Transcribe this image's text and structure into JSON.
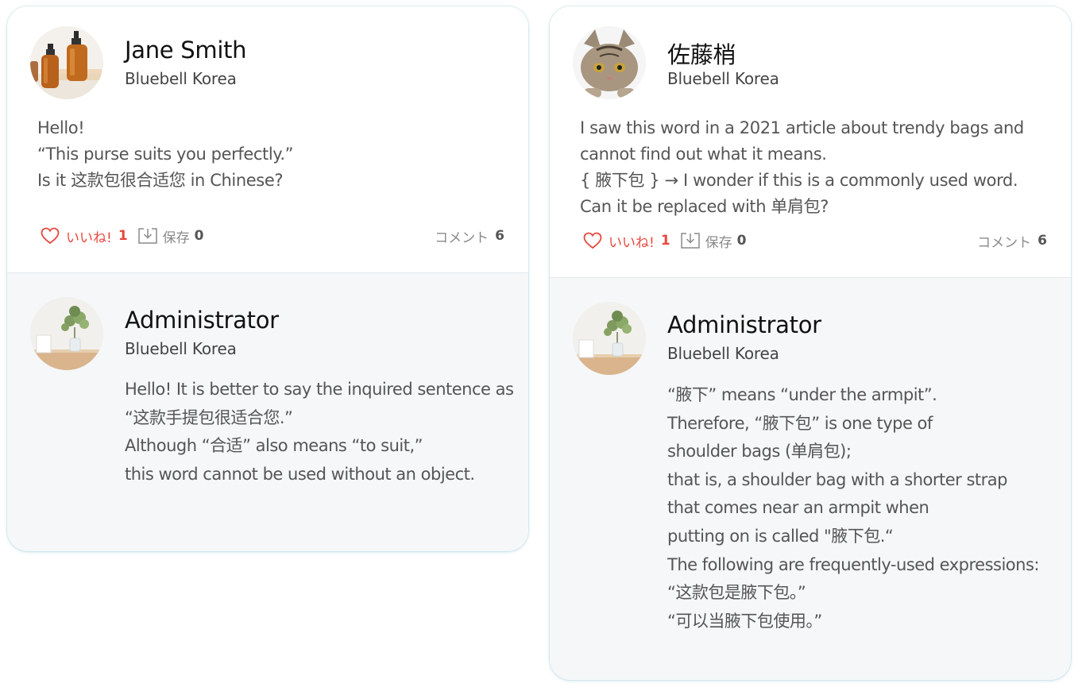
{
  "cards": [
    {
      "question": {
        "author": "Jane Smith",
        "company": "Bluebell Korea",
        "avatar": "amber-bottles-photo",
        "lines": [
          "Hello!",
          "“This purse suits you perfectly.”",
          "Is it 这款包很合适您 in Chinese?"
        ],
        "like_label": "いいね!",
        "like_count": "1",
        "save_label": "保存",
        "save_count": "0",
        "comment_label": "コメント",
        "comment_count": "6"
      },
      "answer": {
        "author": "Administrator",
        "company": "Bluebell Korea",
        "avatar": "plant-vase-photo",
        "lines": [
          "Hello! It is better to say the inquired sentence as",
          "“这款手提包很适合您.”",
          "Although  “合适” also means “to suit,”",
          "this word cannot be used without an object."
        ]
      }
    },
    {
      "question": {
        "author": "佐藤梢",
        "company": "Bluebell Korea",
        "avatar": "tabby-cat-photo",
        "lines": [
          "I saw this word in a 2021 article about trendy bags and",
          "cannot find out what it means.",
          "{ 腋下包 } → I wonder if this is a commonly used word.",
          "Can it be replaced with 单肩包?"
        ],
        "like_label": "いいね!",
        "like_count": "1",
        "save_label": "保存",
        "save_count": "0",
        "comment_label": "コメント",
        "comment_count": "6"
      },
      "answer": {
        "author": "Administrator",
        "company": "Bluebell Korea",
        "avatar": "plant-vase-photo",
        "lines": [
          "“腋下” means “under the armpit”.",
          "Therefore, “腋下包” is one type of",
          "shoulder bags (单肩包);",
          "that is, a shoulder bag with a shorter strap",
          "that comes near an armpit when",
          "putting on is called \"腋下包.“",
          "The following are frequently-used expressions:",
          "“这款包是腋下包。”",
          "“可以当腋下包使用。”"
        ]
      }
    }
  ],
  "colors": {
    "like": "#e8483f",
    "muted": "#8a8a8a",
    "answer_bg": "#f5f7f9",
    "card_border": "#e6f2f6"
  }
}
